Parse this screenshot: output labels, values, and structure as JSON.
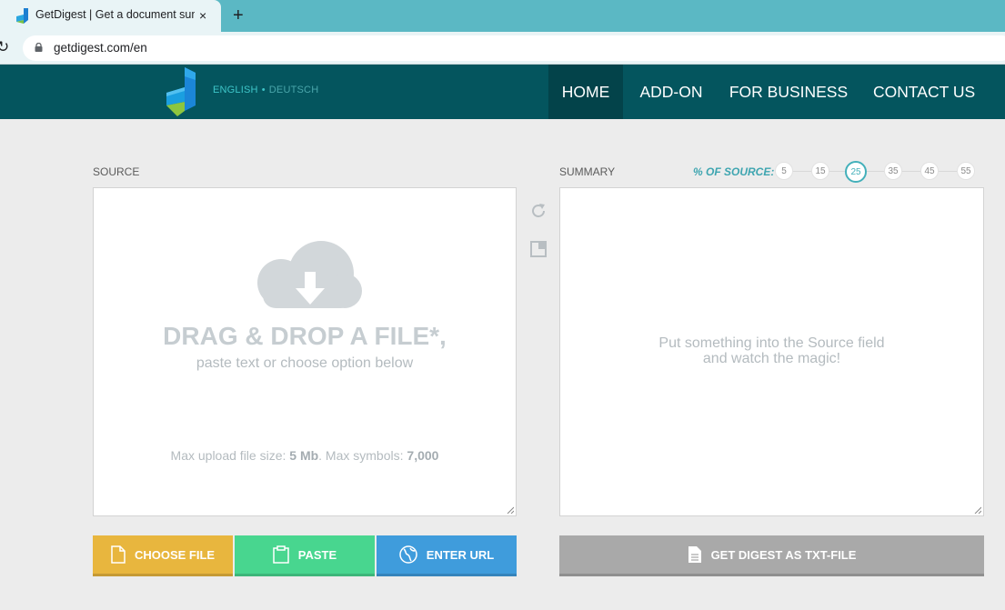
{
  "browser": {
    "tab_title": "GetDigest | Get a document summary",
    "tab_close": "×",
    "new_tab": "+",
    "reload": "↻",
    "url": "getdigest.com/en"
  },
  "header": {
    "lang_active": "ENGLISH",
    "lang_sep": "•",
    "lang_other": "DEUTSCH",
    "nav": [
      "HOME",
      "ADD-ON",
      "FOR BUSINESS",
      "CONTACT US"
    ],
    "active_nav": "HOME"
  },
  "source": {
    "label": "SOURCE",
    "drop_title": "DRAG & DROP A FILE*,",
    "drop_sub": "paste text or choose option below",
    "limits_prefix": "Max upload file size: ",
    "max_size": "5 Mb",
    "limits_mid": ". Max symbols: ",
    "max_symbols": "7,000"
  },
  "summary": {
    "label": "SUMMARY",
    "pct_label": "% OF SOURCE:",
    "pct_options": [
      "5",
      "15",
      "25",
      "35",
      "45",
      "55"
    ],
    "pct_selected": "25",
    "placeholder_line1": "Put something into the Source field",
    "placeholder_line2": "and watch the magic!"
  },
  "buttons": {
    "choose_file": "CHOOSE FILE",
    "paste": "PASTE",
    "enter_url": "ENTER URL",
    "get_digest": "GET DIGEST AS TXT-FILE"
  },
  "colors": {
    "header_bg": "#04555e",
    "nav_active_bg": "#03434a",
    "choose_file": "#e8b63e",
    "paste": "#48d68f",
    "enter_url": "#3f9cdc",
    "get_digest": "#a9a9a9",
    "accent": "#43b0ba"
  }
}
